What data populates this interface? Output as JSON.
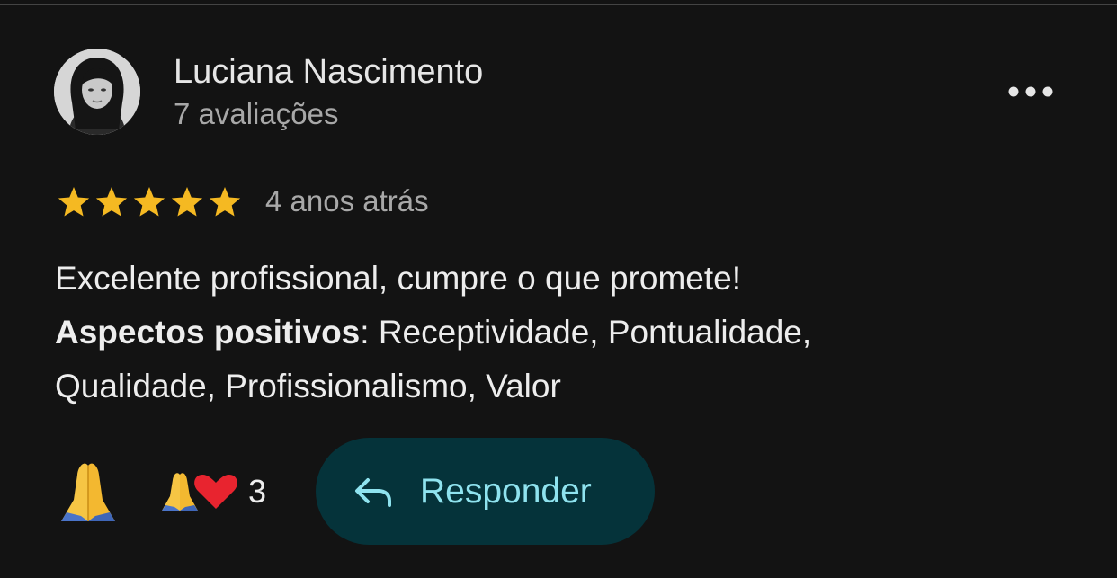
{
  "review": {
    "author_name": "Luciana Nascimento",
    "author_review_count": "7 avaliações",
    "rating": 5,
    "rating_max": 5,
    "time_ago": "4 anos atrás",
    "text_line1": "Excelente profissional, cumpre o que promete!",
    "positive_label": "Aspectos positivos",
    "positive_list_line1": ": Receptividade, Pontualidade,",
    "positive_list_line2": "Qualidade, Profissionalismo, Valor"
  },
  "icons": {
    "more": "more-horizontal-icon",
    "react": "folded-hands-emoji",
    "reaction_summary": [
      "folded-hands-emoji",
      "red-heart-emoji"
    ],
    "reply": "reply-arrow-icon"
  },
  "reactions": {
    "count": "3"
  },
  "actions": {
    "reply_label": "Responder"
  },
  "colors": {
    "background": "#131313",
    "star": "#f5b922",
    "reply_button_bg": "#05333a",
    "reply_button_text": "#8fe3ef"
  }
}
